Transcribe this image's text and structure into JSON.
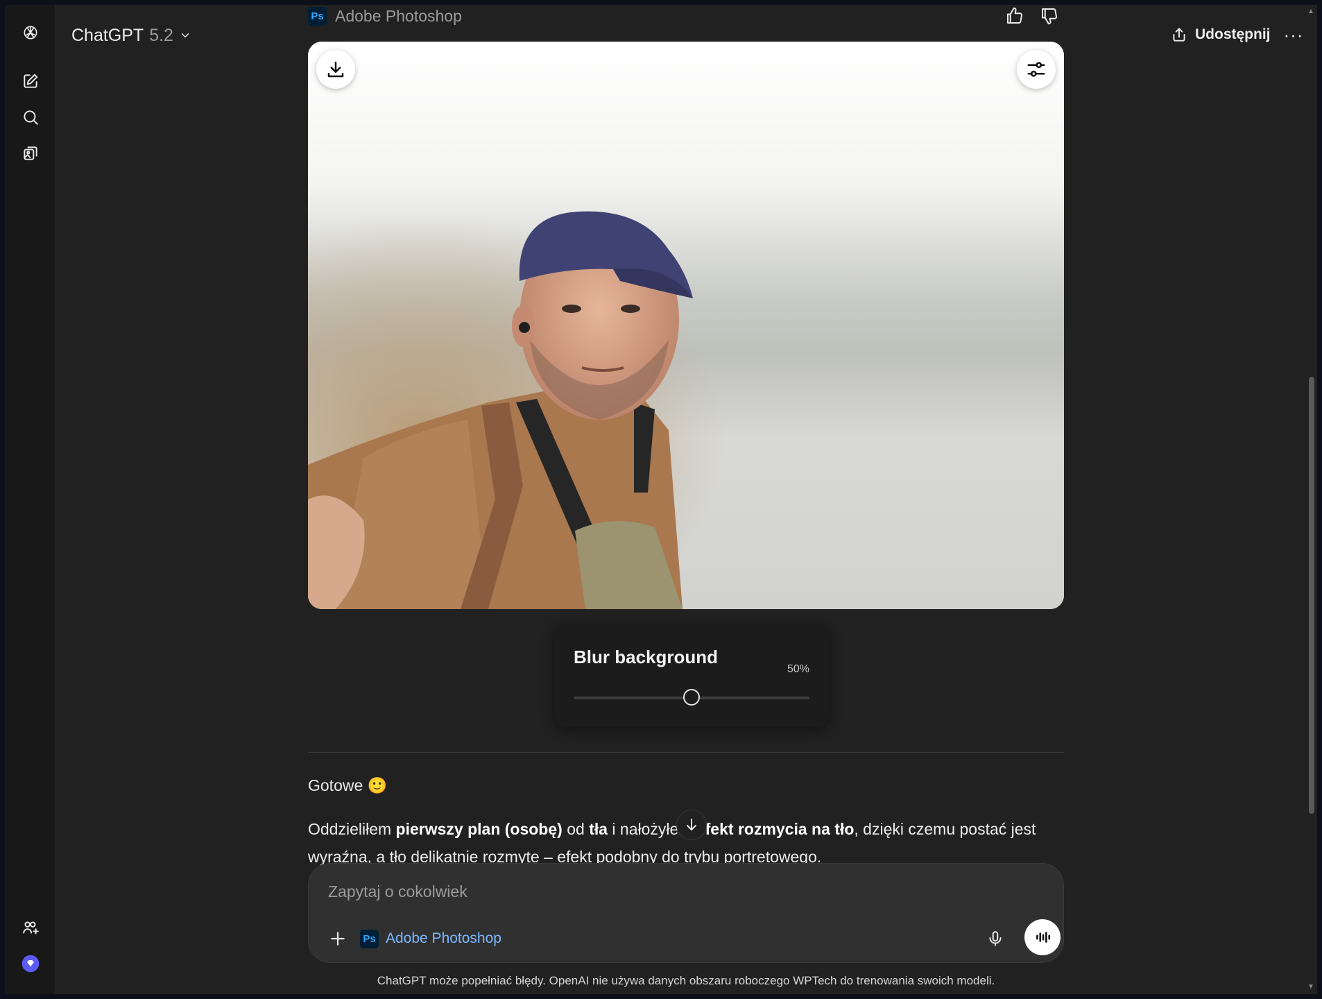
{
  "header": {
    "model_name": "ChatGPT",
    "model_version": "5.2",
    "share_label": "Udostępnij",
    "more_label": "···"
  },
  "rail": {
    "icons": [
      "openai-logo-icon",
      "new-chat-icon",
      "search-icon",
      "library-icon",
      "add-people-icon",
      "upgrade-icon"
    ]
  },
  "message": {
    "app_name": "Adobe Photoshop",
    "app_logo_text": "Ps",
    "blur_control": {
      "title": "Blur background",
      "value_label": "50%",
      "value": 0.5
    },
    "reply_intro": "Gotowe",
    "reply_emoji": "🙂",
    "reply_paragraph": {
      "p1": "Oddzieliłem ",
      "b1": "pierwszy plan (osobę)",
      "p2": " od ",
      "b2": "tła",
      "p3": " i nałożyłem ",
      "b3": "efekt rozmycia na tło",
      "p4": ", dzięki czemu postać jest wyraźna, a tło delikatnie rozmyte – efekt podobny do trybu portretowego."
    }
  },
  "composer": {
    "placeholder": "Zapytaj o cokolwiek",
    "tool_name": "Adobe Photoshop",
    "tool_logo_text": "Ps"
  },
  "footer": {
    "disclaimer": "ChatGPT może popełniać błędy. OpenAI nie używa danych obszaru roboczego WPTech do trenowania swoich modeli."
  },
  "colors": {
    "background": "#212121",
    "rail": "#181818",
    "composer": "#303030",
    "link": "#7cb8ff",
    "upgrade": "#5b5bf7"
  }
}
